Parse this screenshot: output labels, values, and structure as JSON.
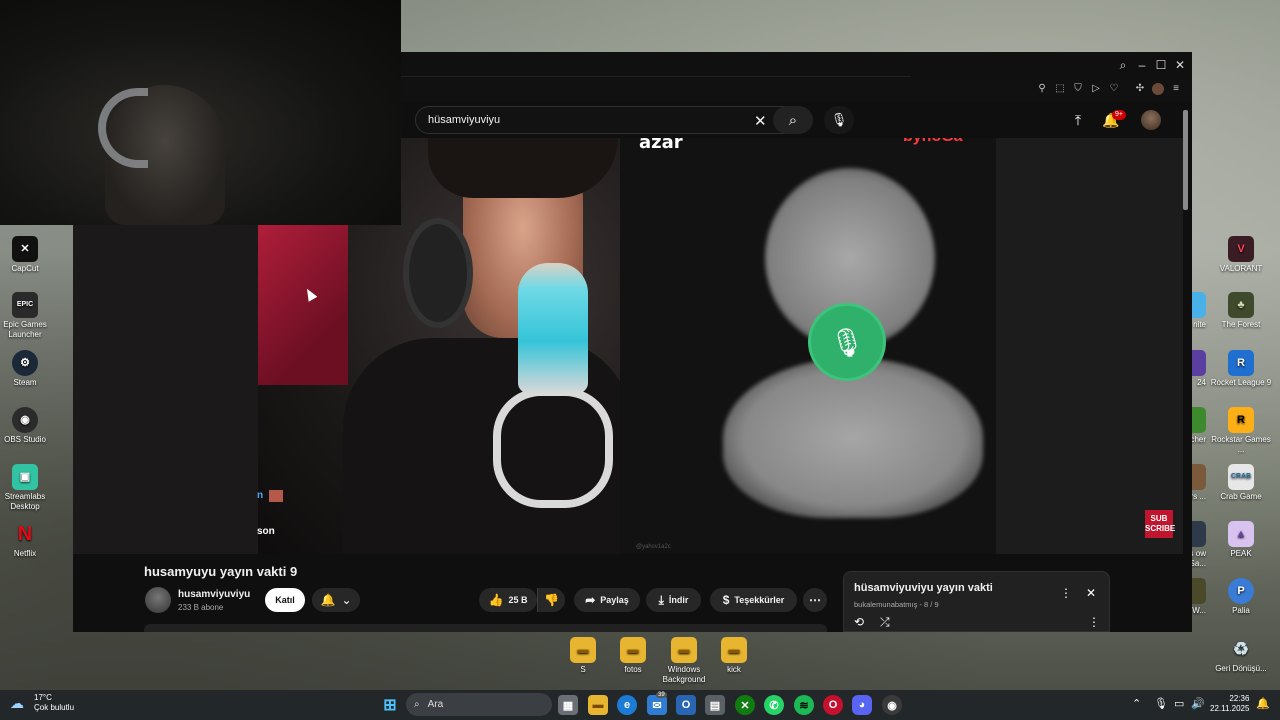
{
  "desktop": {
    "left_icons": [
      {
        "label": "CapCut",
        "glyph": "✕",
        "color": "#111111"
      },
      {
        "label": "Epic Games Launcher",
        "glyph": "EPIC",
        "color": "#2a2a2a"
      },
      {
        "label": "Steam",
        "glyph": "⚙",
        "color": "#1b2838"
      },
      {
        "label": "OBS Studio",
        "glyph": "◉",
        "color": "#2b2b2b"
      },
      {
        "label": "Streamlabs Desktop",
        "glyph": "▣",
        "color": "#31c3a2"
      },
      {
        "label": "Netflix",
        "glyph": "N",
        "color": "#e50914"
      }
    ],
    "right_icons": [
      {
        "label": "VALORANT",
        "glyph": "V",
        "color": "#fd4556"
      },
      {
        "label": "The Forest",
        "glyph": "♣",
        "color": "#3f4a2c"
      },
      {
        "label": "Rocket League 9",
        "glyph": "🚀",
        "color": "#1f6fd1"
      },
      {
        "label": "Rockstar Games ...",
        "glyph": "R",
        "color": "#fcaf17"
      },
      {
        "label": "Crab Game",
        "glyph": "C",
        "color": "#e7e7e7"
      },
      {
        "label": "PEAK",
        "glyph": "▲",
        "color": "#d8c3f0"
      },
      {
        "label": "Palia",
        "glyph": "P",
        "color": "#3a7bd5"
      },
      {
        "label": "Geri Dönüşü...",
        "glyph": "♻",
        "color": "#8fb3c9"
      }
    ],
    "right_partial_labels": [
      "nite",
      "24",
      "craft cher",
      "ape irs ...",
      "ancy's ow Sa...",
      "of W..."
    ],
    "folders": [
      {
        "label": "S"
      },
      {
        "label": "fotos"
      },
      {
        "label": "Windows Background"
      },
      {
        "label": "kick"
      }
    ]
  },
  "browser": {
    "search_value": "hüsamviyuviyu",
    "notif_count": "9+",
    "video_overlay": {
      "azar": "azar",
      "brand": "bynoGa",
      "sub_badge": "SUB SCRIBE",
      "chat_1": "n",
      "chat_2": "son",
      "watermark": "@yahsv1a2c"
    }
  },
  "video": {
    "title": "husamyuyu yayın vakti 9",
    "channel_name": "husamviyuviyu",
    "subscribers": "233 B abone",
    "join_label": "Katıl",
    "likes": "25 B",
    "share_label": "Paylaş",
    "download_label": "İndir",
    "thanks_label": "Teşekkürler"
  },
  "playlist": {
    "title": "hüsamviyuviyu yayın vakti",
    "meta": "bukalemunabatmış - 8 / 9"
  },
  "taskbar": {
    "weather_temp": "17°C",
    "weather_desc": "Çok bulutlu",
    "search_placeholder": "Ara",
    "mail_badge": "39",
    "time": "22:36",
    "date": "22.11.2025"
  }
}
